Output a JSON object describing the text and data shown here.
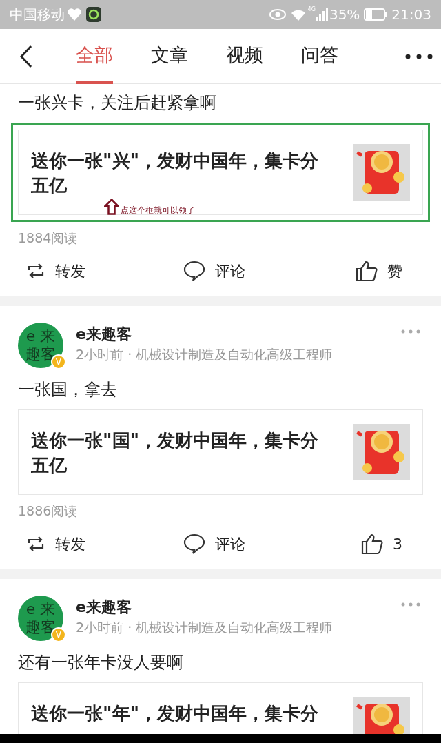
{
  "status_bar": {
    "carrier": "中国移动",
    "network": "4G",
    "battery": "35%",
    "time": "21:03"
  },
  "tabs": [
    {
      "label": "全部",
      "selected": true
    },
    {
      "label": "文章",
      "selected": false
    },
    {
      "label": "视频",
      "selected": false
    },
    {
      "label": "问答",
      "selected": false
    }
  ],
  "posts": [
    {
      "text": "一张兴卡，关注后赶紧拿啊",
      "card": {
        "title": "送你一张\"兴\"，发财中国年，集卡分五亿",
        "highlighted": true,
        "note": "点这个框就可以领了"
      },
      "reads": "1884阅读",
      "actions": {
        "share": "转发",
        "comment": "评论",
        "like": "赞"
      }
    },
    {
      "author": {
        "name": "e来趣客",
        "avatar_text": [
          "e 来",
          "趣客"
        ],
        "badge": "v"
      },
      "meta": "2小时前 · 机械设计制造及自动化高级工程师",
      "text": "一张国，拿去",
      "card": {
        "title": "送你一张\"国\"，发财中国年，集卡分五亿",
        "highlighted": false
      },
      "reads": "1886阅读",
      "actions": {
        "share": "转发",
        "comment": "评论",
        "like": "3"
      }
    },
    {
      "author": {
        "name": "e来趣客",
        "avatar_text": [
          "e 来",
          "趣客"
        ],
        "badge": "v"
      },
      "meta": "2小时前 · 机械设计制造及自动化高级工程师",
      "text": "还有一张年卡没人要啊",
      "card": {
        "title": "送你一张\"年\"，发财中国年，集卡分",
        "highlighted": false
      }
    }
  ]
}
